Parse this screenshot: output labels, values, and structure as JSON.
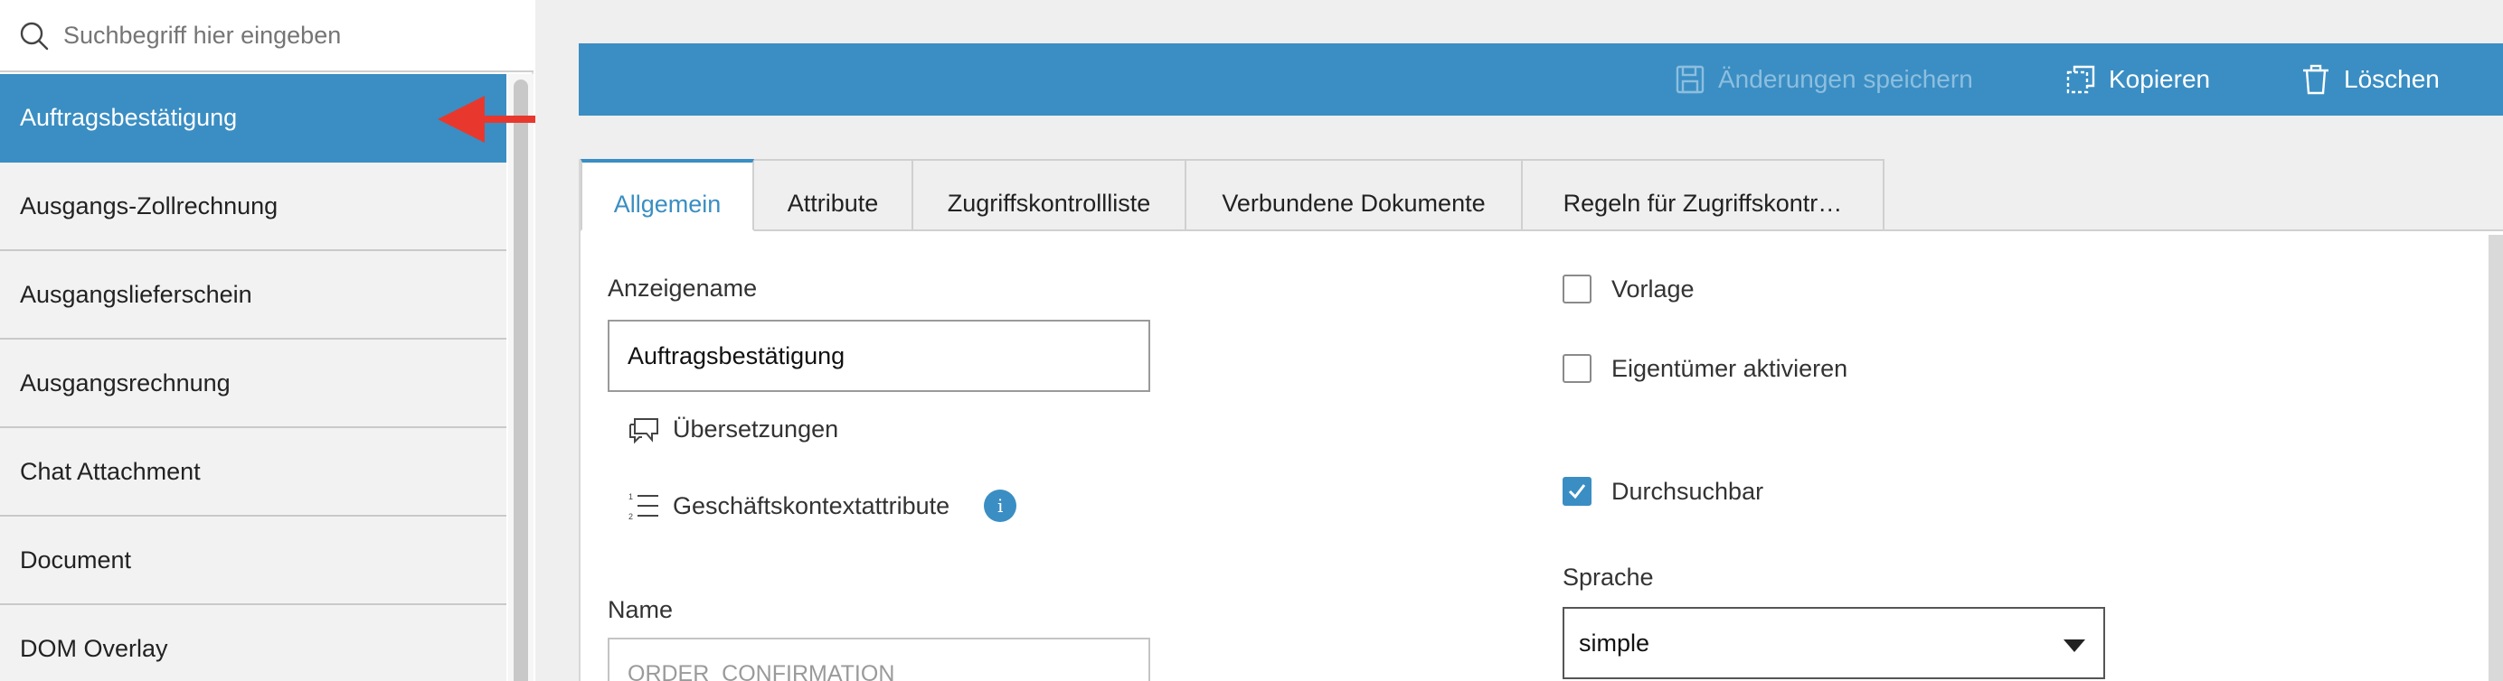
{
  "search": {
    "placeholder": "Suchbegriff hier eingeben"
  },
  "list": {
    "items": [
      {
        "label": "Auftragsbestätigung",
        "selected": true
      },
      {
        "label": "Ausgangs-Zollrechnung"
      },
      {
        "label": "Ausgangslieferschein"
      },
      {
        "label": "Ausgangsrechnung"
      },
      {
        "label": "Chat Attachment"
      },
      {
        "label": "Document"
      },
      {
        "label": "DOM Overlay"
      }
    ]
  },
  "toolbar": {
    "save_label": "Änderungen speichern",
    "copy_label": "Kopieren",
    "delete_label": "Löschen"
  },
  "tabs": [
    {
      "label": "Allgemein",
      "active": true
    },
    {
      "label": "Attribute"
    },
    {
      "label": "Zugriffskontrollliste"
    },
    {
      "label": "Verbundene Dokumente"
    },
    {
      "label": "Regeln für Zugriffskontr…"
    }
  ],
  "form": {
    "display_name_label": "Anzeigename",
    "display_name_value": "Auftragsbestätigung",
    "translations_label": "Übersetzungen",
    "business_context_label": "Geschäftskontextattribute",
    "info_glyph": "i",
    "name_label": "Name",
    "name_value": "ORDER_CONFIRMATION",
    "template_label": "Vorlage",
    "template_checked": false,
    "owner_label": "Eigentümer aktivieren",
    "owner_checked": false,
    "searchable_label": "Durchsuchbar",
    "searchable_checked": true,
    "language_label": "Sprache",
    "language_value": "simple"
  },
  "colors": {
    "accent": "#3a8ec3",
    "arrow": "#e8382d"
  },
  "icons": {
    "search": "search-icon",
    "save": "floppy-disk-icon",
    "copy": "copy-icon",
    "delete": "trash-icon",
    "translations": "speech-bubbles-icon",
    "business_context": "numbered-list-icon",
    "info": "info-icon",
    "language_dropdown": "caret-down-icon"
  }
}
